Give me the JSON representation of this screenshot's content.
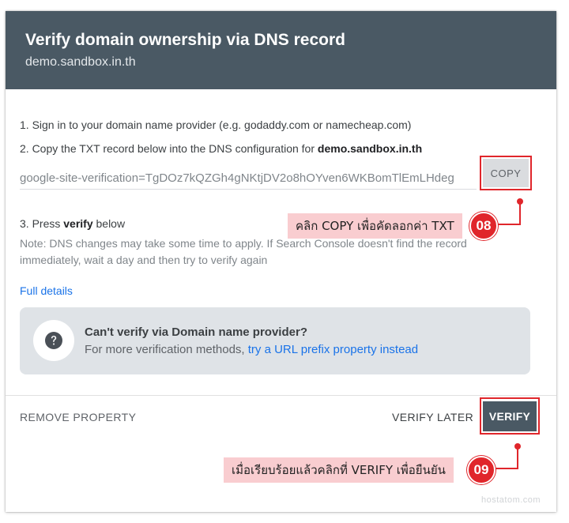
{
  "header": {
    "title": "Verify domain ownership via DNS record",
    "subtitle": "demo.sandbox.in.th"
  },
  "steps": {
    "step1": "1. Sign in to your domain name provider (e.g. godaddy.com or namecheap.com)",
    "step2_prefix": "2. Copy the TXT record below into the DNS configuration for ",
    "step2_domain": "demo.sandbox.in.th",
    "step3_prefix": "3. Press ",
    "step3_bold": "verify",
    "step3_suffix": " below"
  },
  "txt_record": {
    "value": "google-site-verification=TgDOz7kQZGh4gNKtjDV2o8hOYven6WKBomTlEmLHdeg",
    "copy_label": "COPY"
  },
  "note": "Note: DNS changes may take some time to apply. If Search Console doesn't find the record immediately, wait a day and then try to verify again",
  "full_details_label": "Full details",
  "info_box": {
    "title": "Can't verify via Domain name provider?",
    "desc_prefix": "For more verification methods, ",
    "link_label": "try a URL prefix property instead",
    "icon": "help-icon"
  },
  "footer": {
    "remove_label": "REMOVE PROPERTY",
    "verify_later_label": "VERIFY LATER",
    "verify_label": "VERIFY"
  },
  "annotations": {
    "callout_copy": "คลิก COPY เพื่อคัดลอกค่า TXT",
    "badge_copy": "08",
    "callout_verify": "เมื่อเรียบร้อยแล้วคลิกที่ VERIFY เพื่อยืนยัน",
    "badge_verify": "09",
    "accent_color": "#e0262b",
    "callout_bg": "#f9cdd0"
  },
  "watermark": "hostatom.com",
  "colors": {
    "header_bg": "#4a5964",
    "link": "#1a73e8",
    "info_bg": "#dfe3e7"
  }
}
